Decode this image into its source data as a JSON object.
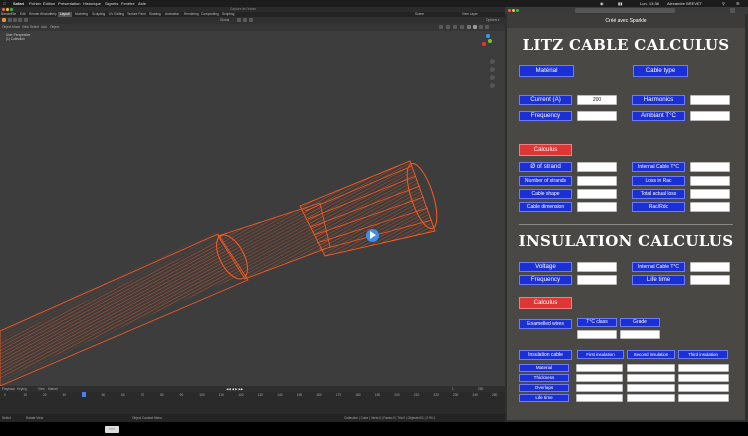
{
  "menubar": {
    "app_name": "Safari",
    "items": [
      "Fichier",
      "Édition",
      "Présentation",
      "Historique",
      "Signets",
      "Fenêtre",
      "Aide"
    ],
    "status": "Lun. 13:38",
    "user": "Alexandre BREVET"
  },
  "blender": {
    "window_title": "Capture de l'écran",
    "menus": [
      "Blender",
      "File",
      "Edit",
      "Render",
      "Window",
      "Help"
    ],
    "workspaces": [
      "Layout",
      "Modeling",
      "Sculpting",
      "UV Editing",
      "Texture Paint",
      "Shading",
      "Animation",
      "Rendering",
      "Compositing",
      "Scripting"
    ],
    "active_workspace": "Layout",
    "scene": "Scene",
    "view_layer": "View Layer",
    "object_mode": "Object Mode",
    "view_menus": [
      "View",
      "Select",
      "Add",
      "Object"
    ],
    "transform": "Global",
    "viewport_label": "User Perspective",
    "collection_label": "(1) Collection",
    "timeline_menus": [
      "Playback",
      "Keying",
      "View",
      "Marker"
    ],
    "timeline_start": "1",
    "timeline_end": "250",
    "frame_numbers": [
      "0",
      "10",
      "20",
      "30",
      "40",
      "50",
      "60",
      "70",
      "80",
      "90",
      "100",
      "110",
      "120",
      "130",
      "140",
      "150",
      "160",
      "170",
      "180",
      "190",
      "200",
      "210",
      "220",
      "230",
      "240",
      "250"
    ],
    "status_left": [
      "Select",
      "Rotate View",
      "Object Context Menu"
    ],
    "status_right": "Collection | Cube | Verts:0 | Faces:0 | Tris:0 | Objects:0/1 | 2.90.1"
  },
  "colors": {
    "cable": "#ff5a1f",
    "button_blue": "#1a2fd4",
    "button_red": "#e03535",
    "panel_bg": "#4a4845"
  },
  "app": {
    "header": "Créé avec Sparkle",
    "litz_title": "LITZ CABLE CALCULUS",
    "material_btn": "Matérial",
    "cable_type_btn": "Cable type",
    "current_label": "Current (A)",
    "current_value": "200",
    "harmonics_label": "Harmonics",
    "frequency_label": "Frequency",
    "ambient_label": "Ambiant T°C",
    "calculus_btn": "Calculus",
    "strand_dia": "Ø of strand",
    "num_strands": "Number of strands",
    "cable_shape": "Cable shape",
    "cable_dimension": "Cable dimension",
    "internal_temp": "Internal Cable T°C",
    "loss_rac": "Loss in Rac",
    "total_loss": "Total actual loss",
    "rac_rdc": "Rac/Rdc",
    "insulation_title": "INSULATION CALCULUS",
    "voltage": "Voltage",
    "ins_frequency": "Frequency",
    "ins_internal_temp": "Internal Cable T°C",
    "life_time": "Life time",
    "ins_calculus": "Calculus",
    "enamelled": "Enamelled wires",
    "tc_class": "T°C class",
    "grade": "Grade",
    "insulation_cable": "Insulation cable",
    "first_ins": "First insulation",
    "second_ins": "Second insulation",
    "third_ins": "Third insulation",
    "row_labels": [
      "Material",
      "Thickness",
      "Overlaps",
      "Life time"
    ]
  }
}
